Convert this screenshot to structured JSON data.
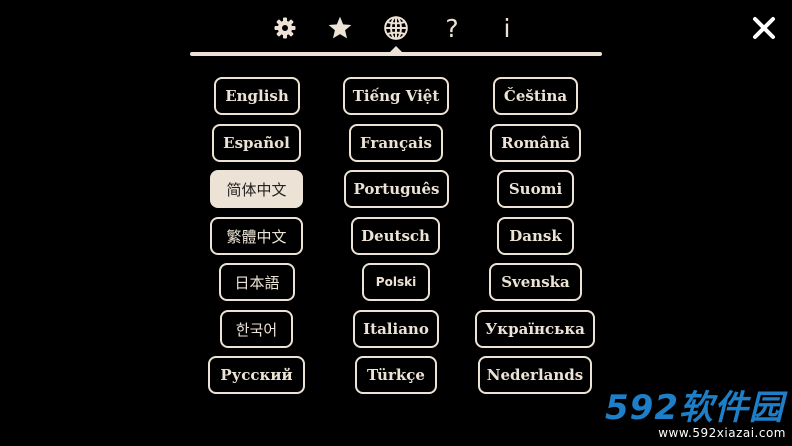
{
  "tabs": [
    {
      "icon": "gear-icon"
    },
    {
      "icon": "star-icon"
    },
    {
      "icon": "globe-icon",
      "active": true
    },
    {
      "icon": "question-icon",
      "glyph": "?"
    },
    {
      "icon": "info-icon",
      "glyph": "i"
    }
  ],
  "languages": {
    "english": "English",
    "tieng_viet": "Tiếng Việt",
    "cestina": "Čeština",
    "espanol": "Español",
    "francais": "Français",
    "romana": "Română",
    "zh_hans": "简体中文",
    "portugues": "Português",
    "suomi": "Suomi",
    "zh_hant": "繁體中文",
    "deutsch": "Deutsch",
    "dansk": "Dansk",
    "japanese": "日本語",
    "polski": "Polski",
    "svenska": "Svenska",
    "korean": "한국어",
    "italiano": "Italiano",
    "ukrainian": "Українська",
    "russian": "Русский",
    "turkce": "Türkçe",
    "nederlands": "Nederlands"
  },
  "selected_language": "简体中文",
  "watermark": {
    "main": "592软件园",
    "url": "www.592xiazai.com"
  },
  "colors": {
    "background": "#000000",
    "foreground": "#ece3d6",
    "watermark": "#1e7fc8"
  }
}
